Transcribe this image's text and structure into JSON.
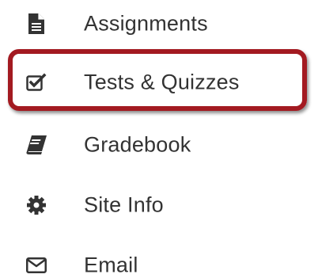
{
  "menu": {
    "items": [
      {
        "label": "Assignments",
        "icon": "document-icon"
      },
      {
        "label": "Tests & Quizzes",
        "icon": "checkbox-checked-icon"
      },
      {
        "label": "Gradebook",
        "icon": "book-icon"
      },
      {
        "label": "Site Info",
        "icon": "gear-icon"
      },
      {
        "label": "Email",
        "icon": "envelope-icon"
      }
    ],
    "highlighted_item": "Tests & Quizzes"
  },
  "colors": {
    "text": "#333333",
    "icon": "#333333",
    "highlight_border": "#a31a21"
  }
}
